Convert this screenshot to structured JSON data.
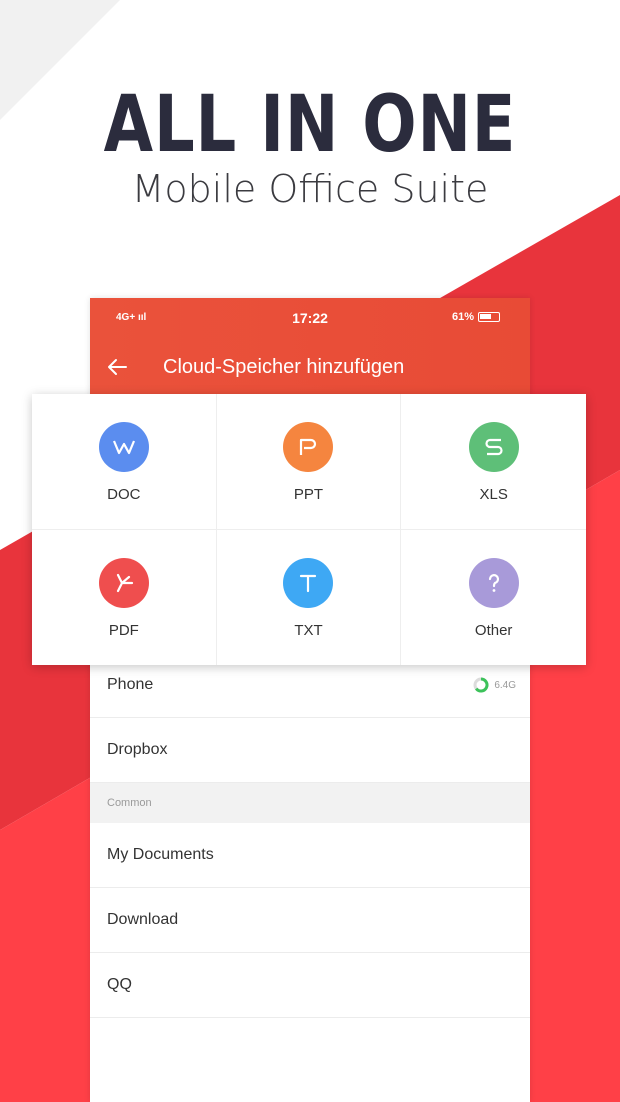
{
  "promo": {
    "headline": "ALL IN ONE",
    "subline": "Mobile Office Suite"
  },
  "status_bar": {
    "network": "4G+ ııl",
    "time": "17:22",
    "battery": "61%"
  },
  "app_bar": {
    "title": "Cloud-Speicher hinzufügen"
  },
  "file_types": [
    {
      "label": "DOC",
      "icon": "doc-w-icon",
      "color": "#5b8def"
    },
    {
      "label": "PPT",
      "icon": "ppt-p-icon",
      "color": "#f5853f"
    },
    {
      "label": "XLS",
      "icon": "xls-s-icon",
      "color": "#5ebf78"
    },
    {
      "label": "PDF",
      "icon": "pdf-icon",
      "color": "#ef4e4e"
    },
    {
      "label": "TXT",
      "icon": "txt-t-icon",
      "color": "#3ea8f4"
    },
    {
      "label": "Other",
      "icon": "question-icon",
      "color": "#a89ad9"
    }
  ],
  "locations": {
    "phone": {
      "label": "Phone",
      "storage": "6.4G"
    },
    "dropbox": "Dropbox",
    "section": "Common",
    "common": [
      "My Documents",
      "Download",
      "QQ"
    ]
  },
  "colors": {
    "accent": "#e84b36",
    "background_red": "#ef3a3f",
    "headline": "#2b2c3d"
  }
}
